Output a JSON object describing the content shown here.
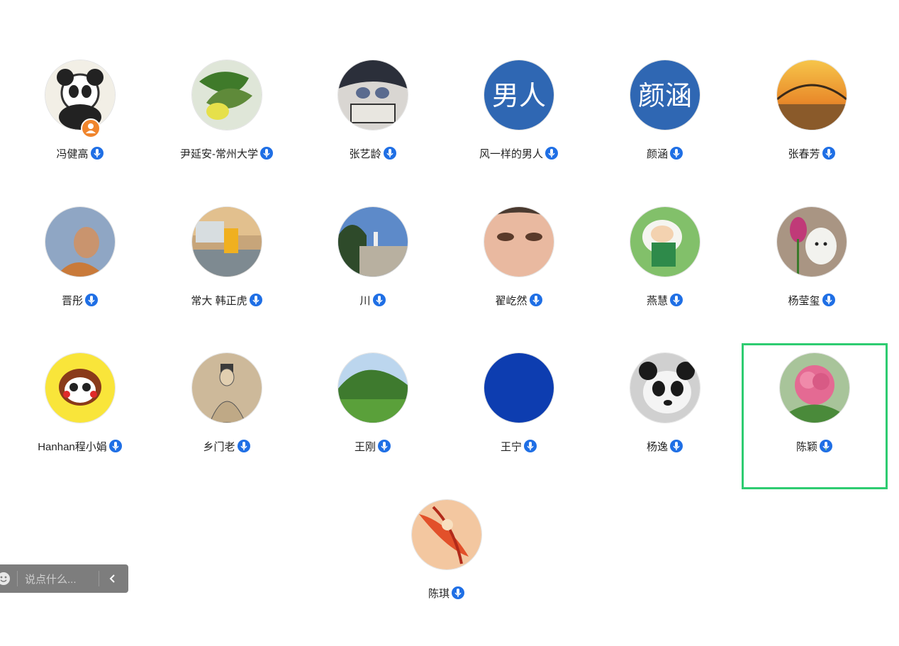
{
  "participants": [
    {
      "name": "冯健高",
      "mic": "on",
      "badge": "user",
      "avatar_color": "#f2efe6"
    },
    {
      "name": "尹延安-常州大学",
      "mic": "on",
      "avatar_color": "#5f8a3a"
    },
    {
      "name": "张艺龄",
      "mic": "on",
      "avatar_color": "#2b2f3a"
    },
    {
      "name": "风一样的男人",
      "mic": "on",
      "avatar_text": "男人",
      "avatar_color": "#2f67b3"
    },
    {
      "name": "颜涵",
      "mic": "on",
      "avatar_text": "颜涵",
      "avatar_color": "#2f67b3"
    },
    {
      "name": "张春芳",
      "mic": "on",
      "avatar_color": "#f0a23a"
    },
    {
      "name": "晋彤",
      "mic": "on",
      "avatar_color": "#8fa6c4"
    },
    {
      "name": "常大 韩正虎",
      "mic": "on",
      "avatar_color": "#7e8a91"
    },
    {
      "name": "川",
      "mic": "on",
      "avatar_color": "#3c5a3a"
    },
    {
      "name": "翟屹然",
      "mic": "on",
      "avatar_color": "#e2a88f"
    },
    {
      "name": "燕慧",
      "mic": "on",
      "avatar_color": "#82c06a"
    },
    {
      "name": "杨莹玺",
      "mic": "on",
      "avatar_color": "#a99583"
    },
    {
      "name": "Hanhan程小娟",
      "mic": "on",
      "avatar_color": "#f9e53a"
    },
    {
      "name": "乡门老",
      "mic": "on",
      "avatar_color": "#cdb99a"
    },
    {
      "name": "王刚",
      "mic": "on",
      "avatar_color": "#4e8d3b"
    },
    {
      "name": "王宁",
      "mic": "on",
      "avatar_color": "#0d3db0"
    },
    {
      "name": "杨逸",
      "mic": "on",
      "avatar_color": "#d0d0d0"
    },
    {
      "name": "陈颖",
      "mic": "on",
      "selected": true,
      "avatar_color": "#e46a93"
    },
    {
      "name": "陈琪",
      "mic": "on",
      "avatar_color": "#e8844a"
    }
  ],
  "chat": {
    "placeholder": "说点什么..."
  },
  "colors": {
    "mic_blue": "#1f6fe5",
    "selected_border": "#2ecc71",
    "badge_orange": "#f0852d"
  }
}
